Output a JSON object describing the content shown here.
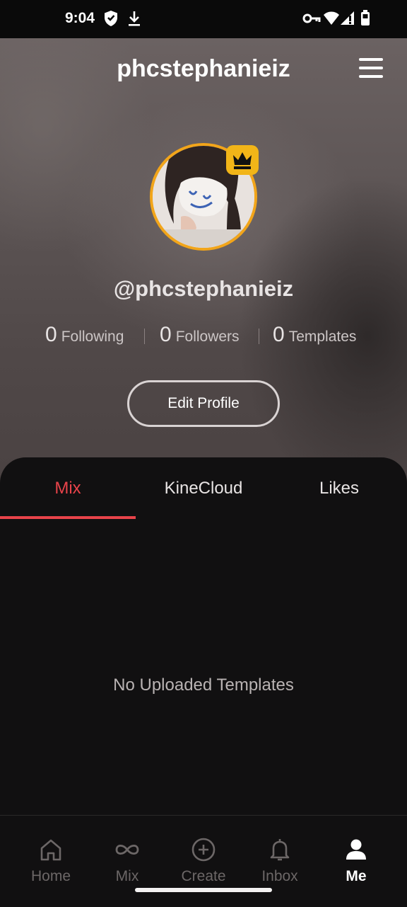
{
  "status_bar": {
    "time": "9:04",
    "left_icons": [
      "shield-icon",
      "download-icon"
    ],
    "right_icons": [
      "vpn-key-icon",
      "wifi-icon",
      "signal-icon",
      "battery-icon"
    ]
  },
  "header": {
    "title": "phcstephanieiz",
    "menu_icon": "hamburger-menu-icon"
  },
  "profile": {
    "handle": "@phcstephanieiz",
    "badge_icon": "crown-icon",
    "stats": [
      {
        "count": "0",
        "label": "Following"
      },
      {
        "count": "0",
        "label": "Followers"
      },
      {
        "count": "0",
        "label": "Templates"
      }
    ],
    "edit_button": "Edit Profile"
  },
  "tabs": [
    {
      "label": "Mix",
      "active": true
    },
    {
      "label": "KineCloud",
      "active": false
    },
    {
      "label": "Likes",
      "active": false
    }
  ],
  "empty_state": "No Uploaded Templates",
  "bottom_nav": [
    {
      "label": "Home",
      "icon": "home-icon",
      "active": false
    },
    {
      "label": "Mix",
      "icon": "infinity-icon",
      "active": false
    },
    {
      "label": "Create",
      "icon": "plus-circle-icon",
      "active": false
    },
    {
      "label": "Inbox",
      "icon": "bell-icon",
      "active": false
    },
    {
      "label": "Me",
      "icon": "person-icon",
      "active": true
    }
  ],
  "colors": {
    "accent": "#e8434a",
    "avatar_ring": "#f2a51a",
    "crown_badge": "#f2b518",
    "background": "#111011"
  }
}
